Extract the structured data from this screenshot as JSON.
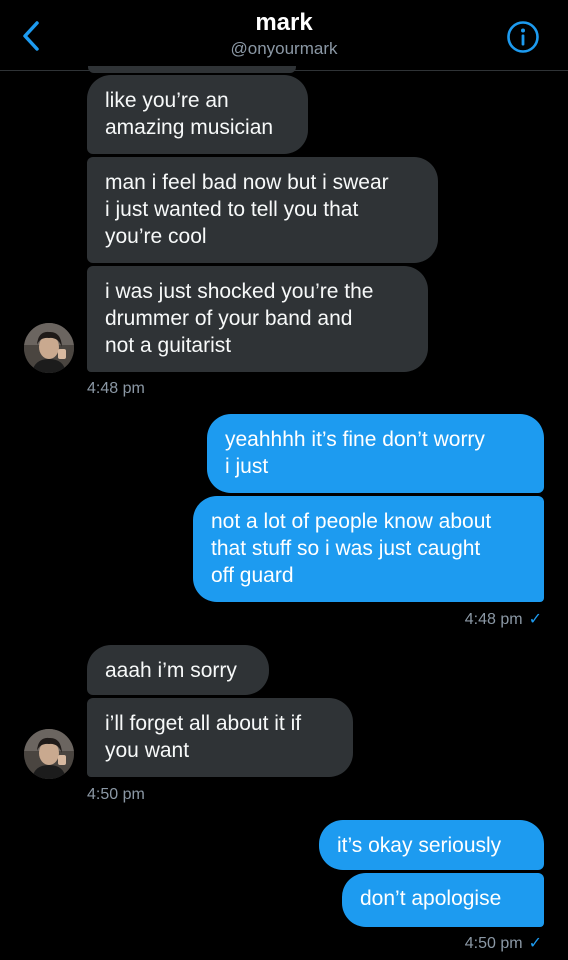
{
  "header": {
    "title": "mark",
    "handle": "@onyourmark",
    "back_icon": "chevron-left-icon",
    "info_icon": "info-circle-icon",
    "accent": "#1d9bf0"
  },
  "messages": [
    {
      "text": "like you’re an\namazing musician",
      "direction": "received"
    },
    {
      "text": "man i feel bad now but i swear\ni just wanted to tell you that\nyou’re cool",
      "direction": "received"
    },
    {
      "text": "i was just shocked you’re the\ndrummer of your band and\nnot a guitarist",
      "direction": "received"
    },
    {
      "text": "yeahhhh it’s fine don’t worry\ni just",
      "direction": "sent"
    },
    {
      "text": "not a lot of people know about\nthat stuff so i was just caught\noff guard",
      "direction": "sent"
    },
    {
      "text": "aaah i’m sorry",
      "direction": "received"
    },
    {
      "text": "i’ll forget all about it if\nyou want",
      "direction": "received"
    },
    {
      "text": "it’s okay seriously",
      "direction": "sent"
    },
    {
      "text": "don’t apologise",
      "direction": "sent"
    }
  ],
  "timestamps": [
    "4:48 pm",
    "4:48 pm",
    "4:50 pm",
    "4:50 pm"
  ],
  "read_mark": "✓",
  "colors": {
    "background": "#000000",
    "received_bubble": "#2f3336",
    "sent_bubble": "#1d9bf0",
    "secondary_text": "#8b98a5"
  }
}
